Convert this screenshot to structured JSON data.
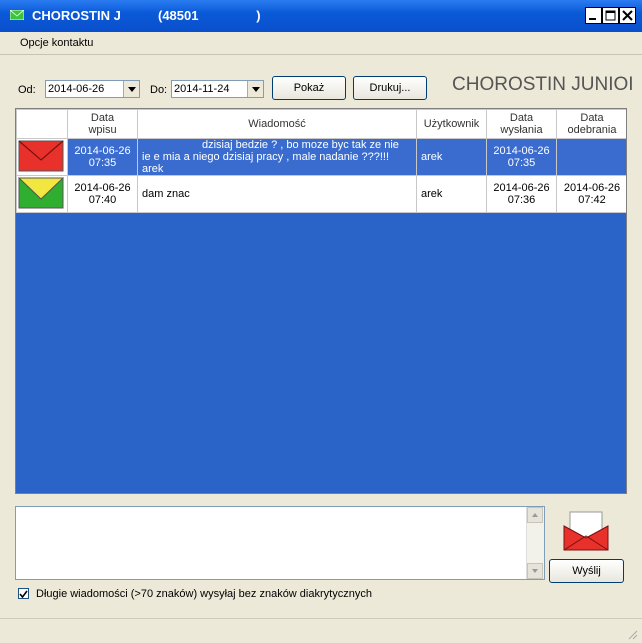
{
  "window": {
    "title": "CHOROSTIN J",
    "title_code": "(48501                )",
    "buttons": {
      "minimize": "_",
      "maximize": "□",
      "close": "X"
    }
  },
  "menu": {
    "items": [
      {
        "label": "Opcje kontaktu"
      }
    ]
  },
  "filters": {
    "from_label": "Od:",
    "from_value": "2014-06-26",
    "to_label": "Do:",
    "to_value": "2014-11-24",
    "show_button": "Pokaż",
    "print_button": "Drukuj..."
  },
  "contact_name": "CHOROSTIN JUNIOI",
  "table": {
    "headers": [
      "",
      "Data wpisu",
      "Wiadomość",
      "Użytkownik",
      "Data wysłania",
      "Data odebrania"
    ],
    "rows": [
      {
        "icon": "envelope-red-icon",
        "date_entry_1": "2014-06-26",
        "date_entry_2": "07:35",
        "message_1": "dzisiaj bedzie ?  , bo moze byc tak ze nie",
        "message_2": "ie e mia    a niego dzisiaj pracy , male nadanie  ???!!!",
        "message_3": "arek",
        "user": "arek",
        "sent_1": "2014-06-26",
        "sent_2": "07:35",
        "received_1": "",
        "received_2": "",
        "selected": true
      },
      {
        "icon": "envelope-yellow-icon",
        "date_entry_1": "2014-06-26",
        "date_entry_2": "07:40",
        "message_1": "dam znac",
        "message_2": "",
        "message_3": "",
        "user": "arek",
        "sent_1": "2014-06-26",
        "sent_2": "07:36",
        "received_1": "2014-06-26",
        "received_2": "07:42",
        "selected": false
      }
    ]
  },
  "compose": {
    "value": "",
    "send_button": "Wyślij"
  },
  "option": {
    "checked": true,
    "label": "Długie wiadomości (>70 znaków) wysyłaj bez znaków diakrytycznych"
  },
  "colors": {
    "titlebar": "#0a5ad8",
    "grid_bg": "#2b64c8",
    "selected_row": "#3a6cd0",
    "envelope_red": "#e8312a",
    "envelope_yellow": "#f2e640",
    "envelope_green": "#2fae2f"
  }
}
